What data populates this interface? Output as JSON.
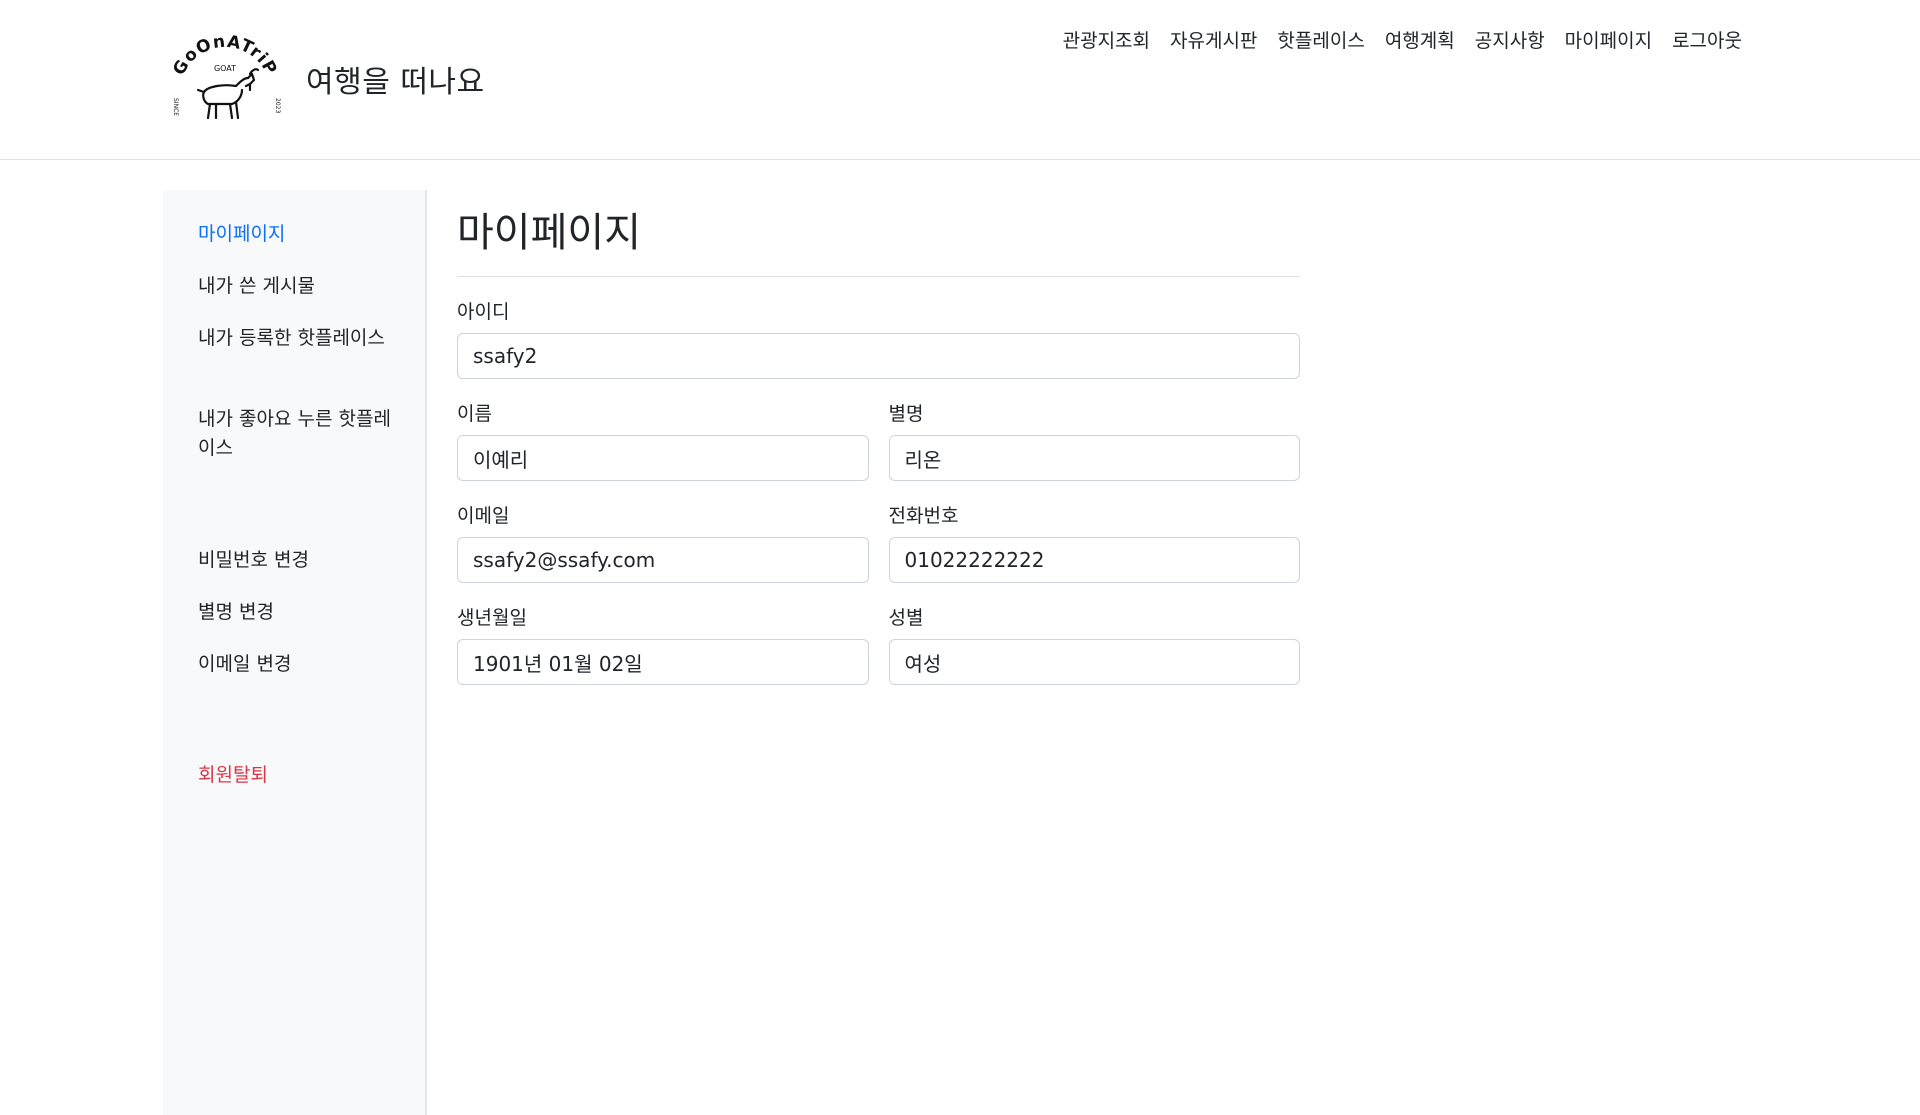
{
  "brand": {
    "logo": {
      "text_top": "GoOnATriP",
      "text_small": "GOAT",
      "left_mark": "SINCE",
      "right_mark": "2023"
    },
    "title": "여행을 떠나요"
  },
  "nav": {
    "items": [
      "관광지조회",
      "자유게시판",
      "핫플레이스",
      "여행계획",
      "공지사항",
      "마이페이지",
      "로그아웃"
    ]
  },
  "sidebar": {
    "items": [
      {
        "label": "마이페이지",
        "state": "active"
      },
      {
        "label": "내가 쓴 게시물"
      },
      {
        "label": "내가 등록한 핫플레이스"
      },
      {
        "label": "내가 좋아요 누른 핫플레이스"
      },
      {
        "label": "비밀번호 변경"
      },
      {
        "label": "별명 변경"
      },
      {
        "label": "이메일 변경"
      },
      {
        "label": "회원탈퇴",
        "state": "danger"
      }
    ]
  },
  "main": {
    "title": "마이페이지",
    "fields": {
      "id": {
        "label": "아이디",
        "value": "ssafy2"
      },
      "name": {
        "label": "이름",
        "value": "이예리"
      },
      "nickname": {
        "label": "별명",
        "value": "리온"
      },
      "email": {
        "label": "이메일",
        "value": "ssafy2@ssafy.com"
      },
      "phone": {
        "label": "전화번호",
        "value": "01022222222"
      },
      "birth": {
        "label": "생년월일",
        "value": "1901년 01월 02일"
      },
      "gender": {
        "label": "성별",
        "value": "여성"
      }
    }
  },
  "colors": {
    "active_link": "#0d6efd",
    "danger_link": "#dc3545",
    "sidebar_bg": "#f8f9fa"
  }
}
